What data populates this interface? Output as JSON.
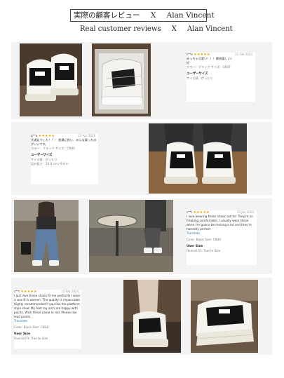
{
  "header": {
    "jp_title": "実際の顧客レビュー",
    "jp_sep": "X",
    "jp_name": "Alan Vincent",
    "en_title": "Real customer reviews",
    "en_sep": "X",
    "en_name": "Alan  Vincent"
  },
  "reviews": [
    {
      "name": "s**e",
      "stars": "★★★★★",
      "date": "21 Feb 2023",
      "body": "めっちゃ可愛い！！！厚底嬉しい！",
      "body2": "好",
      "variant": "カラー：ブラック  サイズ：CN37",
      "user_size_heading": "ユーザーサイズ",
      "user_size": "サイズ感：ぴったり"
    },
    {
      "name": "g**a",
      "stars": "★★★★★",
      "date": "12 Apr 2024",
      "body": "大満足でした！！！ 普通に良い、みんな買ったのがいいです。",
      "variant": "カラー：ブラック  サイズ：CN40",
      "user_size_heading": "ユーザーサイズ",
      "user_size": "サイズ感：ぴったり",
      "extra": "足の長さ：24.0 cm / 9.4 in"
    },
    {
      "name": "s**t",
      "stars": "★★★★★",
      "date": "15 Jan 2024",
      "body": "I love wearing these shoes soll to! They're so freaking comfortable. I usually wear these when I'm gonna be moving a lot and they're honestly perfect",
      "translate": "Translate",
      "variant": "Color: Black    Size: CN40",
      "user_size_heading": "User Size",
      "user_size": "Overall Fit: True to Size"
    },
    {
      "name": "s**t",
      "stars": "★★★★★",
      "date": "15 Feb 2024",
      "body": "I just love these shoes fit me perfectly I wear a size 8 in women. The quality is impeccable. Highly recommended if you like the platform style shoe. My feet my arch are happy with points. Wish these came in red. Please like lead points",
      "translate": "Translate",
      "variant": "Color: Black    Size: CN38",
      "user_size_heading": "User Size",
      "user_size": "Overall Fit: True to Size"
    }
  ],
  "colors": {
    "star": "#e8a200",
    "panel": "#f3f3f3",
    "translate": "#2a7ab0"
  }
}
